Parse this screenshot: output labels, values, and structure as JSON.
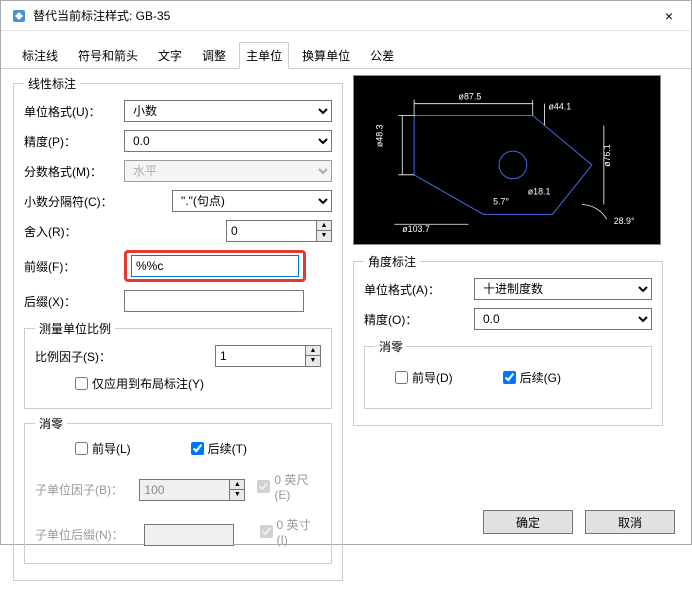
{
  "window": {
    "title": "替代当前标注样式: GB-35",
    "close": "×"
  },
  "tabs": {
    "t0": "标注线",
    "t1": "符号和箭头",
    "t2": "文字",
    "t3": "调整",
    "t4": "主单位",
    "t5": "换算单位",
    "t6": "公差"
  },
  "linear": {
    "legend": "线性标注",
    "unit_format_label": "单位格式(U)：",
    "unit_format_value": "小数",
    "precision_label": "精度(P)：",
    "precision_value": "0.0",
    "fraction_format_label": "分数格式(M)：",
    "fraction_format_value": "水平",
    "decimal_sep_label": "小数分隔符(C)：",
    "decimal_sep_value": "\".\"(句点)",
    "round_label": "舍入(R)：",
    "round_value": "0",
    "prefix_label": "前缀(F)：",
    "prefix_value": "%%c",
    "suffix_label": "后缀(X)：",
    "suffix_value": ""
  },
  "scale": {
    "legend": "测量单位比例",
    "factor_label": "比例因子(S)：",
    "factor_value": "1",
    "layout_only": "仅应用到布局标注(Y)"
  },
  "zero": {
    "legend": "消零",
    "leading": "前导(L)",
    "trailing": "后续(T)",
    "subunit_factor_label": "子单位因子(B)：",
    "subunit_factor_value": "100",
    "subunit_suffix_label": "子单位后缀(N)：",
    "subunit_suffix_value": "",
    "feet": "0 英尺(E)",
    "inches": "0 英寸(I)"
  },
  "angular": {
    "legend": "角度标注",
    "unit_format_label": "单位格式(A)：",
    "unit_format_value": "十进制度数",
    "precision_label": "精度(O)：",
    "precision_value": "0.0",
    "zero_legend": "消零",
    "leading": "前导(D)",
    "trailing": "后续(G)"
  },
  "footer": {
    "ok": "确定",
    "cancel": "取消"
  },
  "preview": {
    "d1": "ø87.5",
    "d2": "ø48.3",
    "d3": "ø44.1",
    "d4": "ø76.1",
    "d5": "ø103.7",
    "d6": "ø18.1",
    "a1": "5.7°",
    "a2": "28.9°"
  }
}
